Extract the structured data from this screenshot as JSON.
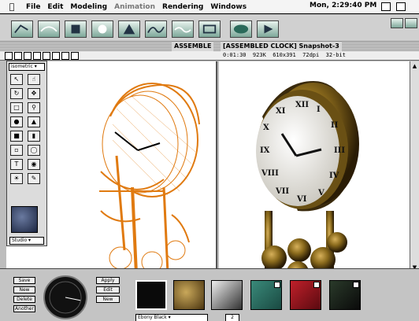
{
  "menubar": {
    "apple_icon": "apple-logo-icon",
    "menus": [
      "File",
      "Edit",
      "Modeling",
      "Animation",
      "Rendering",
      "Windows"
    ],
    "clock": "Mon, 2:29:40 PM"
  },
  "document": {
    "title": "[ASSEMBLED CLOCK] Snapshot-3",
    "title_left_fragment": "ASSEMBLE",
    "stats": "0:01:30  923K  610x391  72dpi  32-bit"
  },
  "tool_palette": {
    "view_select": "isometric",
    "style_select": "Studio"
  },
  "bottom_panel": {
    "left_buttons": [
      "Save",
      "New",
      "Delete",
      "Another"
    ],
    "material_buttons": [
      "Apply",
      "Edit",
      "New"
    ],
    "material_name": "Ebony Black",
    "zoom_value": "2"
  },
  "colors": {
    "wireframe": "#e07a10",
    "brass": "#8a6a1c",
    "accent": "#3a7a6a"
  }
}
